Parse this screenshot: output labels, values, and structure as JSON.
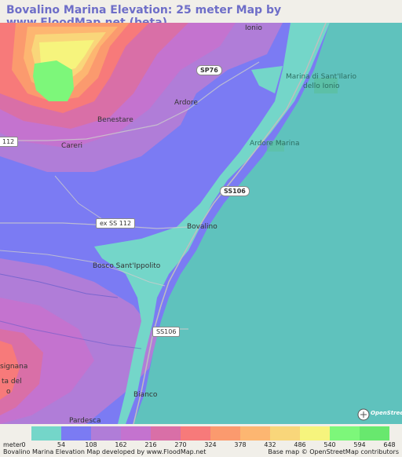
{
  "title": "Bovalino Marina Elevation: 25 meter Map by www.FloodMap.net (beta)",
  "places": {
    "ionio": "Ionio",
    "marina_sant_ilario_1": "Marina di Sant'Ilario",
    "marina_sant_ilario_2": "dello Ionio",
    "ardore": "Ardore",
    "benestare": "Benestare",
    "careri": "Careri",
    "ardore_marina": "Ardore Marina",
    "bovalino": "Bovalino",
    "bosco": "Bosco Sant'Ippolito",
    "signana": "signana",
    "ta_del": "ta del",
    "o": "o",
    "bianco": "Bianco",
    "pardesca": "Pardesca"
  },
  "roads": {
    "sp76": "SP76",
    "ss106_shield": "SS106",
    "ss112_left": "112",
    "ex_ss112": "ex SS 112",
    "ss106_small": "SS106"
  },
  "legend": {
    "unit": "meter",
    "ticks": [
      "0",
      "54",
      "108",
      "162",
      "216",
      "270",
      "324",
      "378",
      "432",
      "486",
      "540",
      "594",
      "648"
    ],
    "colors": [
      "#74d6c9",
      "#7b7bf3",
      "#b07dd8",
      "#c473cf",
      "#d96fa7",
      "#f77a7a",
      "#fb9a6e",
      "#fdb671",
      "#f9d67a",
      "#f6f47d",
      "#7df77a",
      "#68e86e"
    ]
  },
  "footer": {
    "left": "Bovalino Marina Elevation Map developed by www.FloodMap.net",
    "right": "Base map © OpenStreetMap contributors"
  },
  "osm_logo_text": "OpenStreetMap"
}
